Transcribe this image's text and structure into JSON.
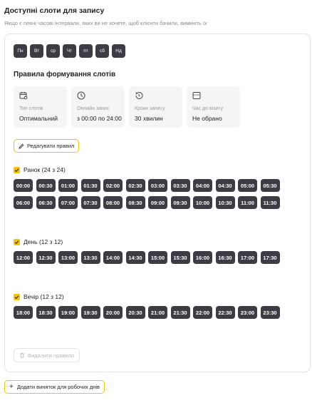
{
  "header": {
    "title": "Доступні слоти для запису",
    "subtitle": "Якщо є певні часові інтервали, яких ви не хочете, щоб клієнти бачили, вимкніть їх"
  },
  "days": [
    "Пн",
    "Вт",
    "ср",
    "Чт",
    "пт",
    "сб",
    "Нд"
  ],
  "rules": {
    "title": "Правила формування слотів",
    "cards": [
      {
        "icon": "calendar-settings-icon",
        "label": "Тип слотів",
        "value": "Оптимальний"
      },
      {
        "icon": "clock-icon",
        "label": "Онлайн запис",
        "value": "з 00:00 по 24:00"
      },
      {
        "icon": "history-icon",
        "label": "Кроки запису",
        "value": "30 хвилин"
      },
      {
        "icon": "window-icon",
        "label": "Час до візиту",
        "value": "Не обрано"
      }
    ],
    "edit_label": "Редагувати правил"
  },
  "groups": [
    {
      "label": "Ранок (24 з 24)",
      "checked": true,
      "slots": [
        "00:00",
        "00:30",
        "01:00",
        "01:30",
        "02:00",
        "02:30",
        "03:00",
        "03:30",
        "04:00",
        "04:30",
        "05:00",
        "05:30",
        "06:00",
        "06:30",
        "07:00",
        "07:30",
        "08:00",
        "08:30",
        "09:00",
        "09:30",
        "10:00",
        "10:30",
        "11:00",
        "11:30"
      ]
    },
    {
      "label": "День (12 з 12)",
      "checked": true,
      "slots": [
        "12:00",
        "12:30",
        "13:00",
        "13:30",
        "14:00",
        "14:30",
        "15:00",
        "15:30",
        "16:00",
        "16:30",
        "17:00",
        "17:30"
      ]
    },
    {
      "label": "Вечір (12 з 12)",
      "checked": true,
      "slots": [
        "18:00",
        "18:30",
        "19:00",
        "19:30",
        "20:00",
        "20:30",
        "21:00",
        "21:30",
        "22:00",
        "22:30",
        "23:00",
        "23:30"
      ]
    }
  ],
  "delete_label": "Видалити правило",
  "add_exception_label": "Додати виняток для робочих днів",
  "colors": {
    "accent": "#f3c300",
    "chip": "#3c3c44"
  }
}
